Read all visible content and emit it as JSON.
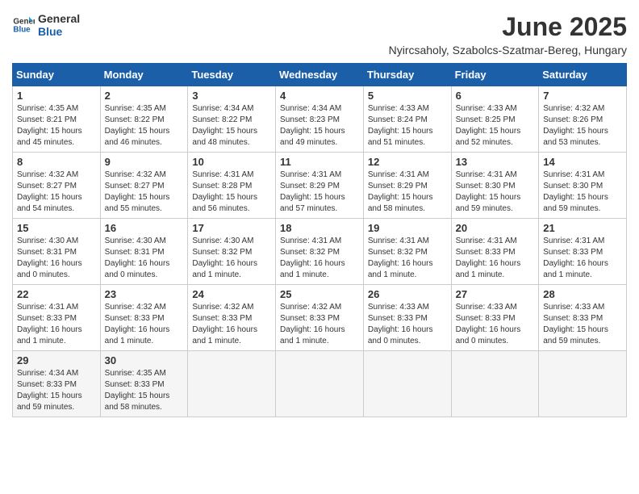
{
  "logo": {
    "text_general": "General",
    "text_blue": "Blue"
  },
  "title": "June 2025",
  "subtitle": "Nyircsaholy, Szabolcs-Szatmar-Bereg, Hungary",
  "headers": [
    "Sunday",
    "Monday",
    "Tuesday",
    "Wednesday",
    "Thursday",
    "Friday",
    "Saturday"
  ],
  "weeks": [
    [
      {
        "day": "1",
        "info": "Sunrise: 4:35 AM\nSunset: 8:21 PM\nDaylight: 15 hours and 45 minutes."
      },
      {
        "day": "2",
        "info": "Sunrise: 4:35 AM\nSunset: 8:22 PM\nDaylight: 15 hours and 46 minutes."
      },
      {
        "day": "3",
        "info": "Sunrise: 4:34 AM\nSunset: 8:22 PM\nDaylight: 15 hours and 48 minutes."
      },
      {
        "day": "4",
        "info": "Sunrise: 4:34 AM\nSunset: 8:23 PM\nDaylight: 15 hours and 49 minutes."
      },
      {
        "day": "5",
        "info": "Sunrise: 4:33 AM\nSunset: 8:24 PM\nDaylight: 15 hours and 51 minutes."
      },
      {
        "day": "6",
        "info": "Sunrise: 4:33 AM\nSunset: 8:25 PM\nDaylight: 15 hours and 52 minutes."
      },
      {
        "day": "7",
        "info": "Sunrise: 4:32 AM\nSunset: 8:26 PM\nDaylight: 15 hours and 53 minutes."
      }
    ],
    [
      {
        "day": "8",
        "info": "Sunrise: 4:32 AM\nSunset: 8:27 PM\nDaylight: 15 hours and 54 minutes."
      },
      {
        "day": "9",
        "info": "Sunrise: 4:32 AM\nSunset: 8:27 PM\nDaylight: 15 hours and 55 minutes."
      },
      {
        "day": "10",
        "info": "Sunrise: 4:31 AM\nSunset: 8:28 PM\nDaylight: 15 hours and 56 minutes."
      },
      {
        "day": "11",
        "info": "Sunrise: 4:31 AM\nSunset: 8:29 PM\nDaylight: 15 hours and 57 minutes."
      },
      {
        "day": "12",
        "info": "Sunrise: 4:31 AM\nSunset: 8:29 PM\nDaylight: 15 hours and 58 minutes."
      },
      {
        "day": "13",
        "info": "Sunrise: 4:31 AM\nSunset: 8:30 PM\nDaylight: 15 hours and 59 minutes."
      },
      {
        "day": "14",
        "info": "Sunrise: 4:31 AM\nSunset: 8:30 PM\nDaylight: 15 hours and 59 minutes."
      }
    ],
    [
      {
        "day": "15",
        "info": "Sunrise: 4:30 AM\nSunset: 8:31 PM\nDaylight: 16 hours and 0 minutes."
      },
      {
        "day": "16",
        "info": "Sunrise: 4:30 AM\nSunset: 8:31 PM\nDaylight: 16 hours and 0 minutes."
      },
      {
        "day": "17",
        "info": "Sunrise: 4:30 AM\nSunset: 8:32 PM\nDaylight: 16 hours and 1 minute."
      },
      {
        "day": "18",
        "info": "Sunrise: 4:31 AM\nSunset: 8:32 PM\nDaylight: 16 hours and 1 minute."
      },
      {
        "day": "19",
        "info": "Sunrise: 4:31 AM\nSunset: 8:32 PM\nDaylight: 16 hours and 1 minute."
      },
      {
        "day": "20",
        "info": "Sunrise: 4:31 AM\nSunset: 8:33 PM\nDaylight: 16 hours and 1 minute."
      },
      {
        "day": "21",
        "info": "Sunrise: 4:31 AM\nSunset: 8:33 PM\nDaylight: 16 hours and 1 minute."
      }
    ],
    [
      {
        "day": "22",
        "info": "Sunrise: 4:31 AM\nSunset: 8:33 PM\nDaylight: 16 hours and 1 minute."
      },
      {
        "day": "23",
        "info": "Sunrise: 4:32 AM\nSunset: 8:33 PM\nDaylight: 16 hours and 1 minute."
      },
      {
        "day": "24",
        "info": "Sunrise: 4:32 AM\nSunset: 8:33 PM\nDaylight: 16 hours and 1 minute."
      },
      {
        "day": "25",
        "info": "Sunrise: 4:32 AM\nSunset: 8:33 PM\nDaylight: 16 hours and 1 minute."
      },
      {
        "day": "26",
        "info": "Sunrise: 4:33 AM\nSunset: 8:33 PM\nDaylight: 16 hours and 0 minutes."
      },
      {
        "day": "27",
        "info": "Sunrise: 4:33 AM\nSunset: 8:33 PM\nDaylight: 16 hours and 0 minutes."
      },
      {
        "day": "28",
        "info": "Sunrise: 4:33 AM\nSunset: 8:33 PM\nDaylight: 15 hours and 59 minutes."
      }
    ],
    [
      {
        "day": "29",
        "info": "Sunrise: 4:34 AM\nSunset: 8:33 PM\nDaylight: 15 hours and 59 minutes."
      },
      {
        "day": "30",
        "info": "Sunrise: 4:35 AM\nSunset: 8:33 PM\nDaylight: 15 hours and 58 minutes."
      },
      {
        "day": "",
        "info": ""
      },
      {
        "day": "",
        "info": ""
      },
      {
        "day": "",
        "info": ""
      },
      {
        "day": "",
        "info": ""
      },
      {
        "day": "",
        "info": ""
      }
    ]
  ]
}
